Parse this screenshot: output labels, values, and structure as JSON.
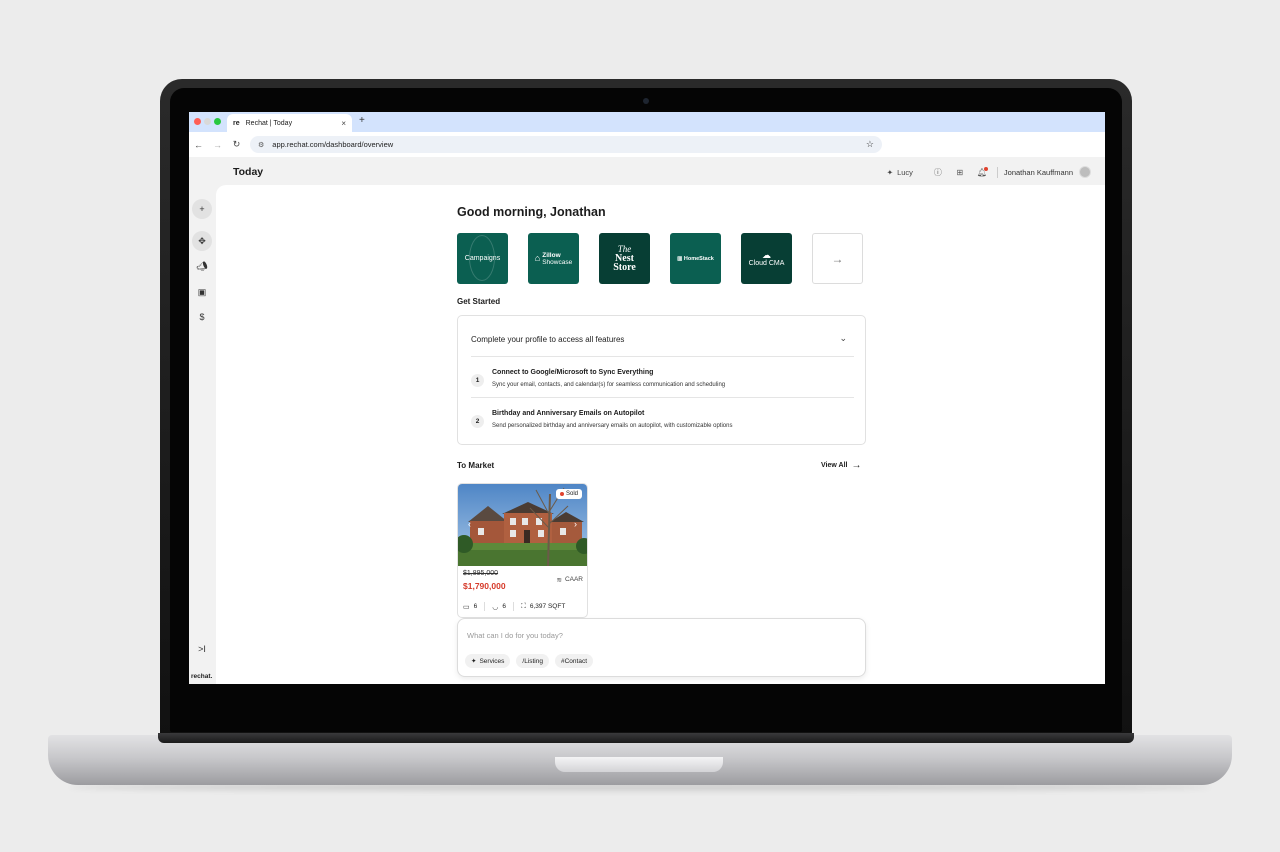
{
  "browser": {
    "tab_favicon": "re",
    "tab_title": "Rechat | Today",
    "tab_close": "×",
    "new_tab": "+",
    "url": "app.rechat.com/dashboard/overview"
  },
  "header": {
    "page_title": "Today",
    "assistant_label": "Lucy",
    "user_name": "Jonathan Kauffmann"
  },
  "sidebar": {
    "items": [
      {
        "icon": "plus-icon"
      },
      {
        "icon": "navigation-icon"
      },
      {
        "icon": "megaphone-icon"
      },
      {
        "icon": "properties-icon"
      },
      {
        "icon": "dollar-icon"
      }
    ],
    "collapse_label": ">I",
    "logo_text": "rechat."
  },
  "main": {
    "greeting": "Good morning, Jonathan",
    "apps": [
      {
        "label": "Campaigns"
      },
      {
        "label_line1": "Zillow",
        "label_line2": "Showcase"
      },
      {
        "label_line1": "The",
        "label_line2": "Nest",
        "label_line3": "Store"
      },
      {
        "label": "HomeStack"
      },
      {
        "label": "Cloud CMA"
      }
    ],
    "get_started": {
      "title": "Get Started",
      "card_heading": "Complete your profile to access all features",
      "steps": [
        {
          "number": "1",
          "title": "Connect to Google/Microsoft to Sync Everything",
          "description": "Sync your email, contacts, and calendar(s) for seamless communication and scheduling"
        },
        {
          "number": "2",
          "title": "Birthday and Anniversary Emails on Autopilot",
          "description": "Send personalized birthday and anniversary emails on autopilot, with customizable options"
        }
      ]
    },
    "to_market": {
      "title": "To Market",
      "view_all": "View All",
      "listings": [
        {
          "status": "Sold",
          "old_price": "$1,895,000",
          "new_price": "$1,790,000",
          "mls": "CAAR",
          "beds": "6",
          "baths": "6",
          "sqft": "6,397 SQFT"
        }
      ]
    },
    "chat": {
      "placeholder": "What can I do for you today?",
      "chips": [
        "Services",
        "/Listing",
        "#Contact"
      ]
    }
  },
  "colors": {
    "brand_green": "#0b5f51",
    "brand_green_dark": "#073e34",
    "price_red": "#d63a2a"
  }
}
